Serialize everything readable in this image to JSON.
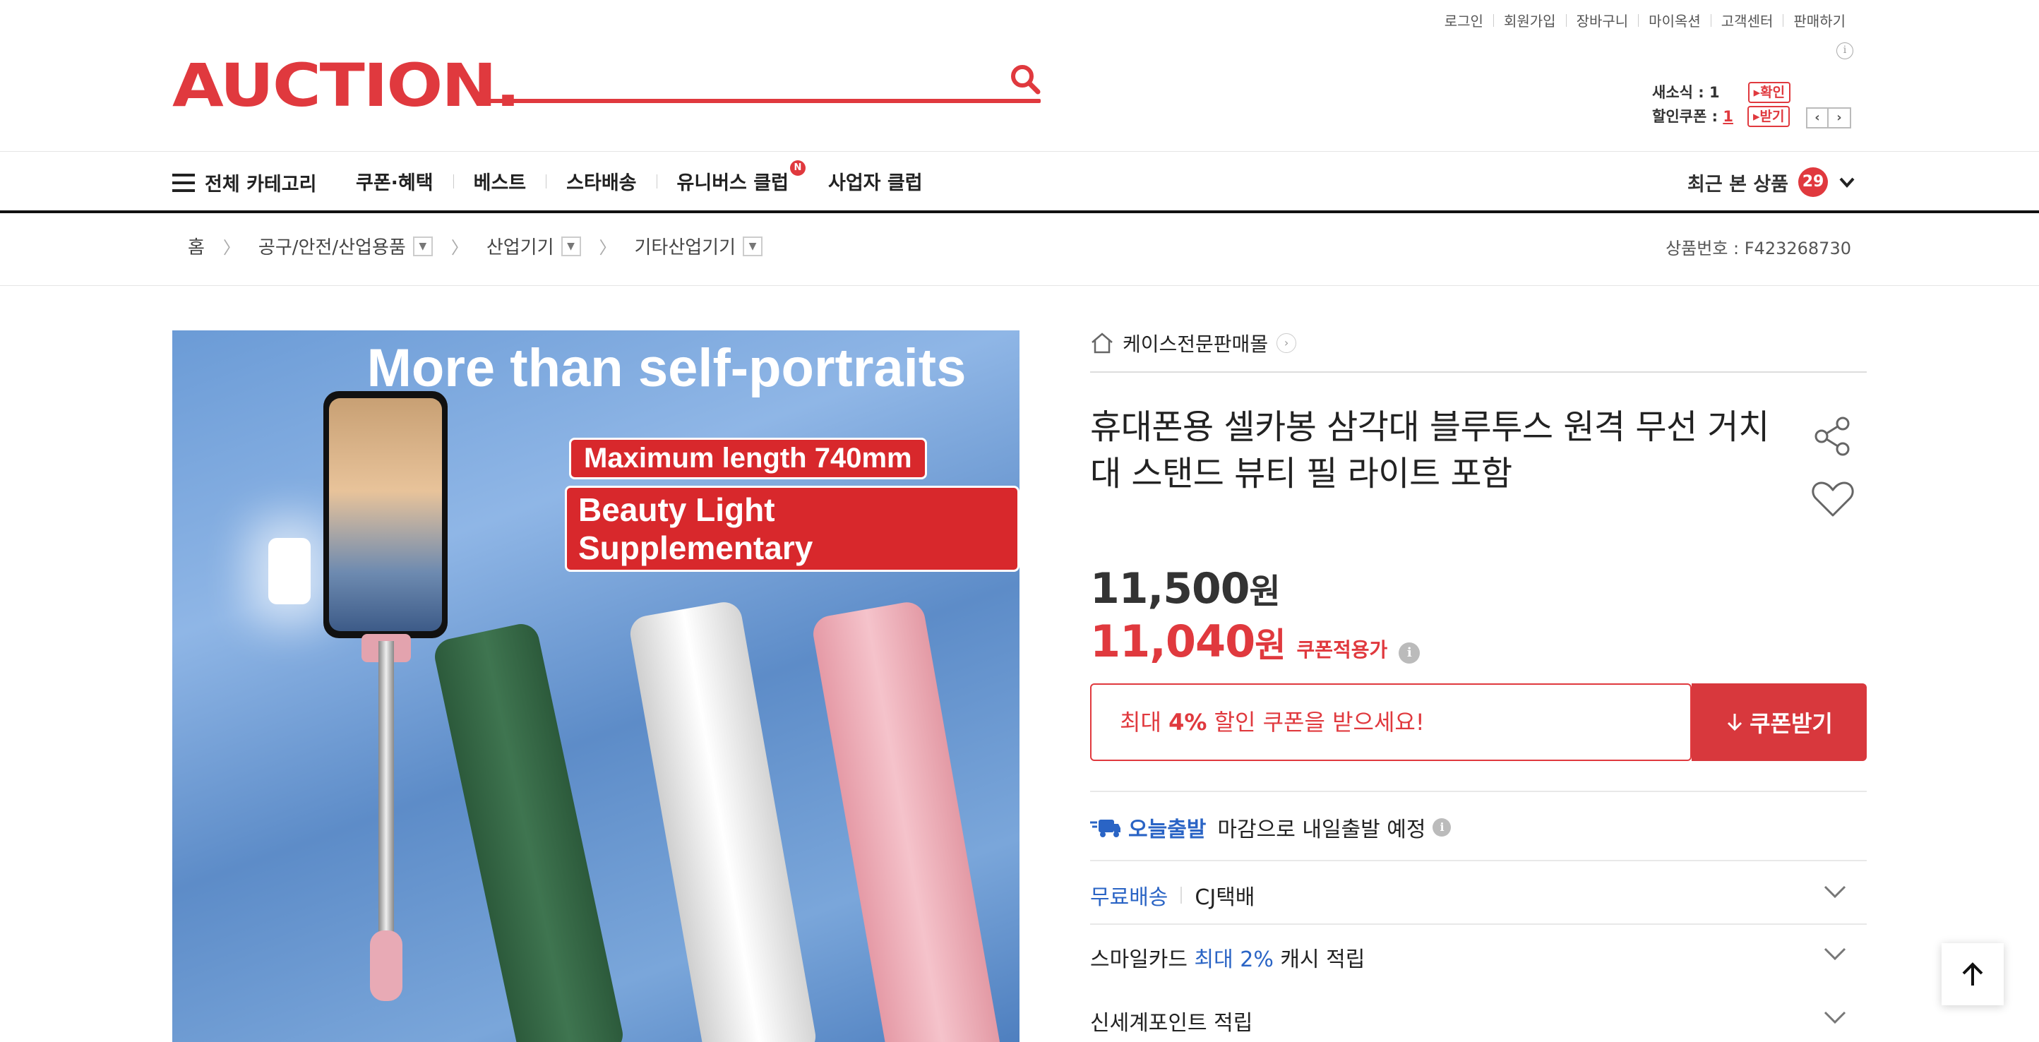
{
  "util_links": [
    "로그인",
    "회원가입",
    "장바구니",
    "마이옥션",
    "고객센터",
    "판매하기"
  ],
  "util_info_icon": "i",
  "logo": "AUCTION.",
  "brand_color": "#e0393e",
  "news": {
    "news_label": "새소식 : ",
    "news_count": "1",
    "news_btn": "확인",
    "coupon_label": "할인쿠폰 : ",
    "coupon_count": "1",
    "coupon_btn": "받기"
  },
  "nav": {
    "all_category": "전체 카테고리",
    "items": [
      "쿠폰·혜택",
      "베스트",
      "스타배송",
      "유니버스 클럽",
      "사업자 클럽"
    ],
    "new_badge": "N",
    "recent_label": "최근 본 상품",
    "recent_count": "29"
  },
  "breadcrumb": {
    "home": "홈",
    "levels": [
      "공구/안전/산업용품",
      "산업기기",
      "기타산업기기"
    ]
  },
  "product_number": "상품번호 : F423268730",
  "image": {
    "headline": "More than self-portraits",
    "pill1": "Maximum length 740mm",
    "pill2": "Beauty Light Supplementary"
  },
  "shop_name": "케이스전문판매몰",
  "title": "휴대폰용 셀카봉 삼각대 블루투스 원격 무선 거치대 스탠드 뷰티 필 라이트 포함",
  "price": {
    "original": "11,500",
    "sale": "11,040",
    "won": "원",
    "coupon_applied_label": "쿠폰적용가"
  },
  "coupon": {
    "prefix": "최대 ",
    "percent": "4%",
    "suffix": " 할인 쿠폰을 받으세요!",
    "button": "쿠폰받기"
  },
  "delivery": {
    "today_label": "오늘출발",
    "today_text": "마감으로 내일출발 예정",
    "free_label": "무료배송",
    "courier": "CJ택배"
  },
  "smile": {
    "prefix": "스마일카드 ",
    "highlight": "최대 2%",
    "suffix": " 캐시 적립"
  },
  "shinsegae": "신세계포인트 적립"
}
